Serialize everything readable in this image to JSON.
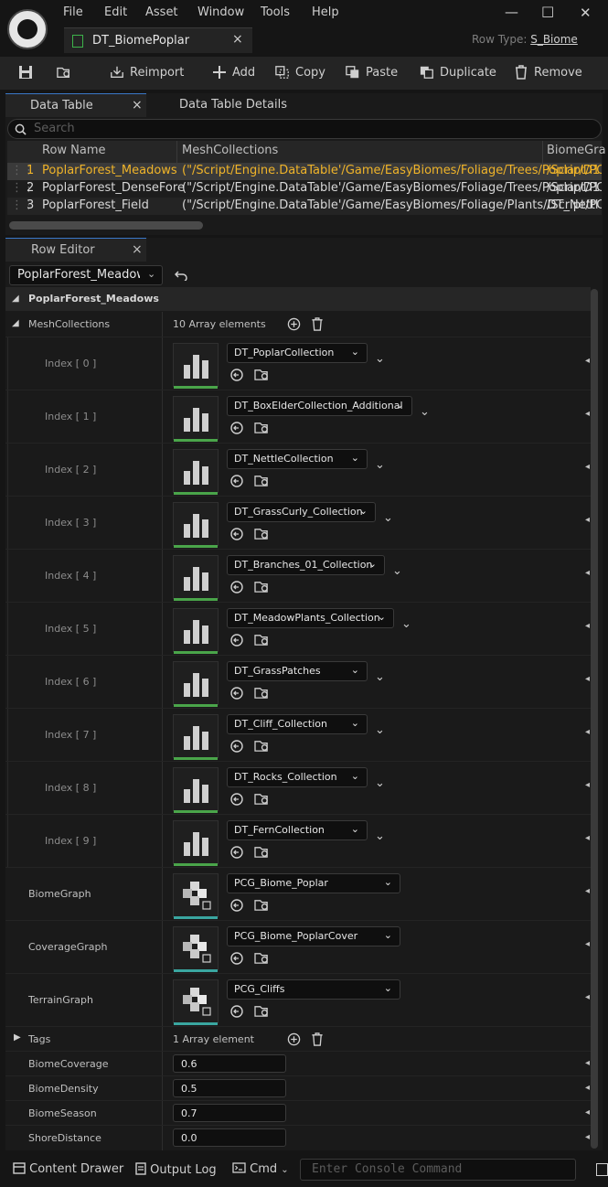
{
  "menu": [
    "File",
    "Edit",
    "Asset",
    "Window",
    "Tools",
    "Help"
  ],
  "doc_tab": {
    "label": "DT_BiomePoplar",
    "close": "×"
  },
  "row_type": {
    "label": "Row Type:",
    "value": "S_Biome"
  },
  "window_buttons": {
    "minimize": "—",
    "maximize": "□",
    "close": "✕"
  },
  "toolbar": {
    "reimport": "Reimport",
    "add": "Add",
    "copy": "Copy",
    "paste": "Paste",
    "duplicate": "Duplicate",
    "remove": "Remove"
  },
  "panel_tabs": {
    "data_table": "Data Table",
    "close": "×",
    "details": "Data Table Details"
  },
  "search": {
    "placeholder": "Search"
  },
  "table": {
    "headers": [
      "Row Name",
      "MeshCollections",
      "BiomeGra"
    ],
    "rows": [
      {
        "num": "1",
        "name": "PoplarForest_Meadows",
        "mesh": "(\"/Script/Engine.DataTable'/Game/EasyBiomes/Foliage/Trees/Poplar/D1",
        "biome": "/Script/PC"
      },
      {
        "num": "2",
        "name": "PoplarForest_DenseFore",
        "mesh": "(\"/Script/Engine.DataTable'/Game/EasyBiomes/Foliage/Trees/Poplar/D1",
        "biome": "/Script/PC"
      },
      {
        "num": "3",
        "name": "PoplarForest_Field",
        "mesh": "(\"/Script/Engine.DataTable'/Game/EasyBiomes/Foliage/Plants/DT_Nettl",
        "biome": "/Script/PC"
      }
    ]
  },
  "row_editor": {
    "tab": "Row Editor",
    "close": "×",
    "selected_row": "PoplarForest_Meadows",
    "section": "PoplarForest_Meadows"
  },
  "mesh_collections": {
    "label": "MeshCollections",
    "count": "10 Array elements",
    "items": [
      {
        "index": "Index [ 0 ]",
        "value": "DT_PoplarCollection"
      },
      {
        "index": "Index [ 1 ]",
        "value": "DT_BoxElderCollection_Additional"
      },
      {
        "index": "Index [ 2 ]",
        "value": "DT_NettleCollection"
      },
      {
        "index": "Index [ 3 ]",
        "value": "DT_GrassCurly_Collection"
      },
      {
        "index": "Index [ 4 ]",
        "value": "DT_Branches_01_Collection"
      },
      {
        "index": "Index [ 5 ]",
        "value": "DT_MeadowPlants_Collection"
      },
      {
        "index": "Index [ 6 ]",
        "value": "DT_GrassPatches"
      },
      {
        "index": "Index [ 7 ]",
        "value": "DT_Cliff_Collection"
      },
      {
        "index": "Index [ 8 ]",
        "value": "DT_Rocks_Collection"
      },
      {
        "index": "Index [ 9 ]",
        "value": "DT_FernCollection"
      }
    ]
  },
  "graphs": [
    {
      "label": "BiomeGraph",
      "value": "PCG_Biome_Poplar"
    },
    {
      "label": "CoverageGraph",
      "value": "PCG_Biome_PoplarCover"
    },
    {
      "label": "TerrainGraph",
      "value": "PCG_Cliffs"
    }
  ],
  "tags": {
    "label": "Tags",
    "count": "1 Array element"
  },
  "numbers": [
    {
      "label": "BiomeCoverage",
      "value": "0.6"
    },
    {
      "label": "BiomeDensity",
      "value": "0.5"
    },
    {
      "label": "BiomeSeason",
      "value": "0.7"
    },
    {
      "label": "ShoreDistance",
      "value": "0.0"
    }
  ],
  "statusbar": {
    "content_drawer": "Content Drawer",
    "output_log": "Output Log",
    "cmd": "Cmd",
    "console_placeholder": "Enter Console Command"
  }
}
